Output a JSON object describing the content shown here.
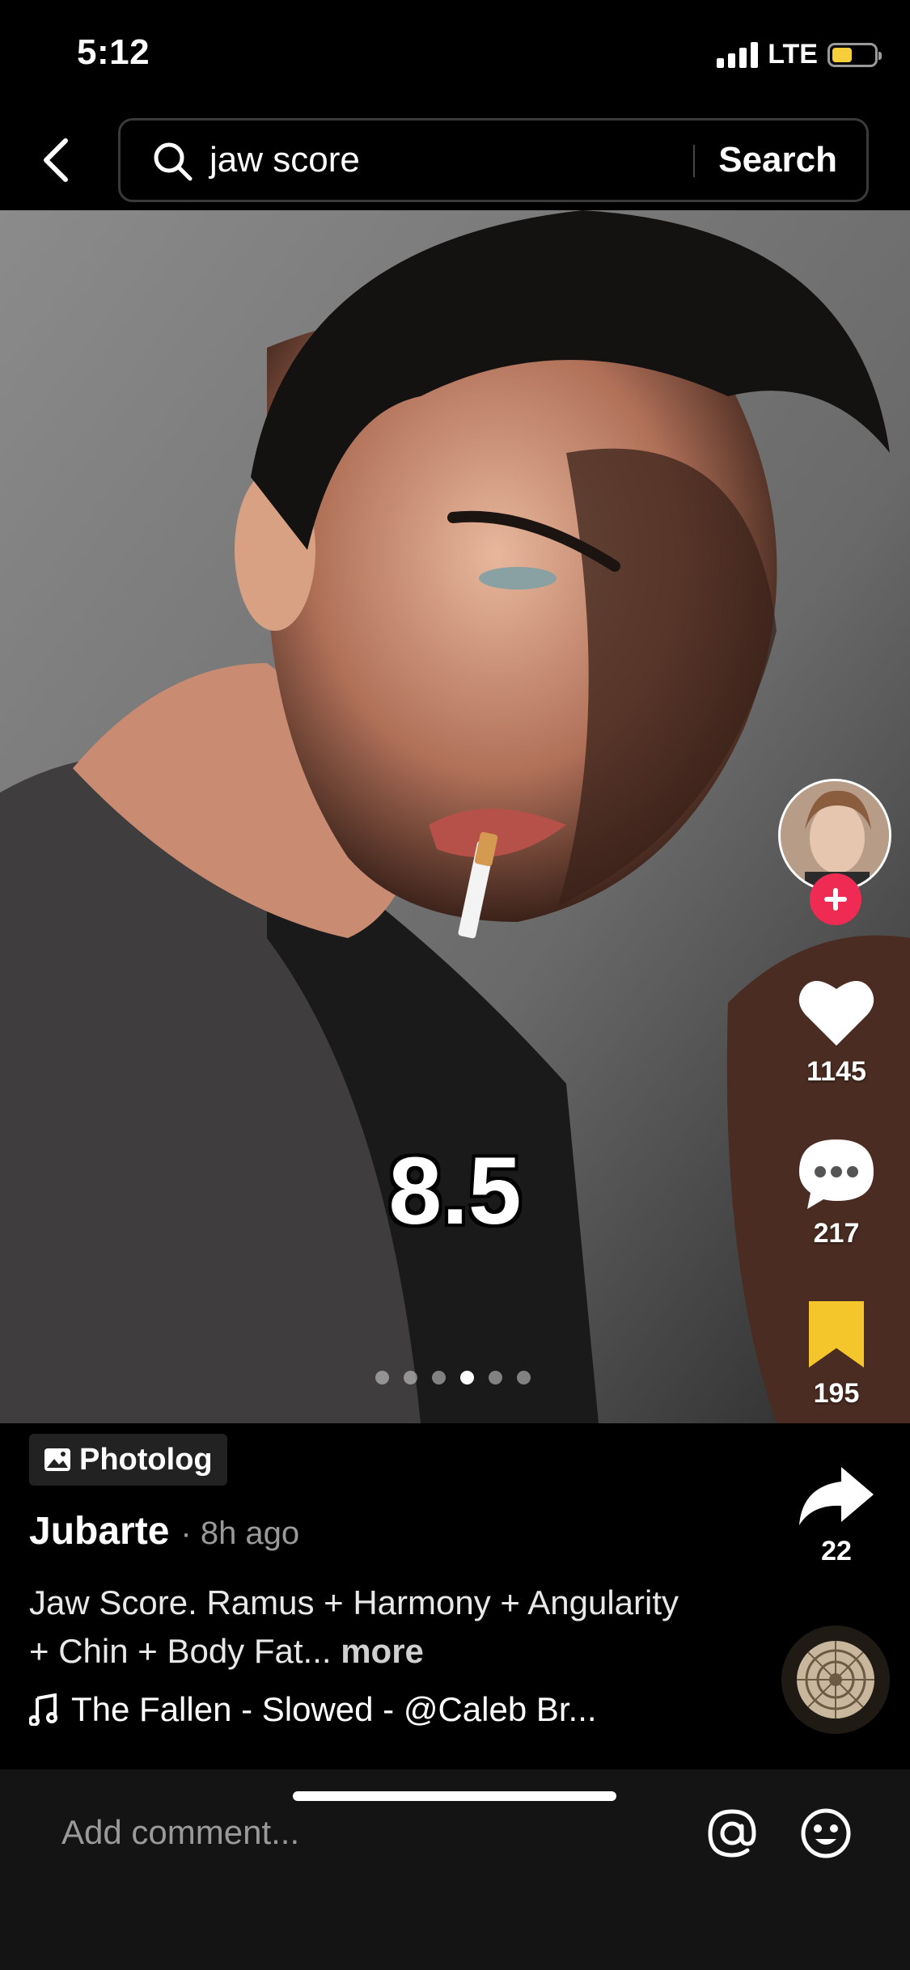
{
  "status_bar": {
    "time": "5:12",
    "network": "LTE",
    "signal_icon": "signal-bars-icon",
    "battery_icon": "battery-icon"
  },
  "search": {
    "query": "jaw score",
    "button": "Search",
    "back_icon": "back-chevron-icon",
    "search_icon": "search-icon"
  },
  "post": {
    "overlay_score": "8.5",
    "carousel": {
      "total": 6,
      "active_index": 3
    },
    "badge": "Photolog",
    "author": "Jubarte",
    "time_ago": "· 8h ago",
    "caption": "Jaw Score. Ramus + Harmony + Angularity + Chin + Body Fat...",
    "more": "more",
    "music": "The Fallen - Slowed - @Caleb Br..."
  },
  "actions": {
    "likes": "1145",
    "comments": "217",
    "saves": "195",
    "shares": "22"
  },
  "comment_bar": {
    "placeholder": "Add comment..."
  },
  "colors": {
    "like": "#ffffff",
    "bookmark": "#f5c62b",
    "follow": "#ef2a53",
    "battery": "#f6cf3a"
  }
}
